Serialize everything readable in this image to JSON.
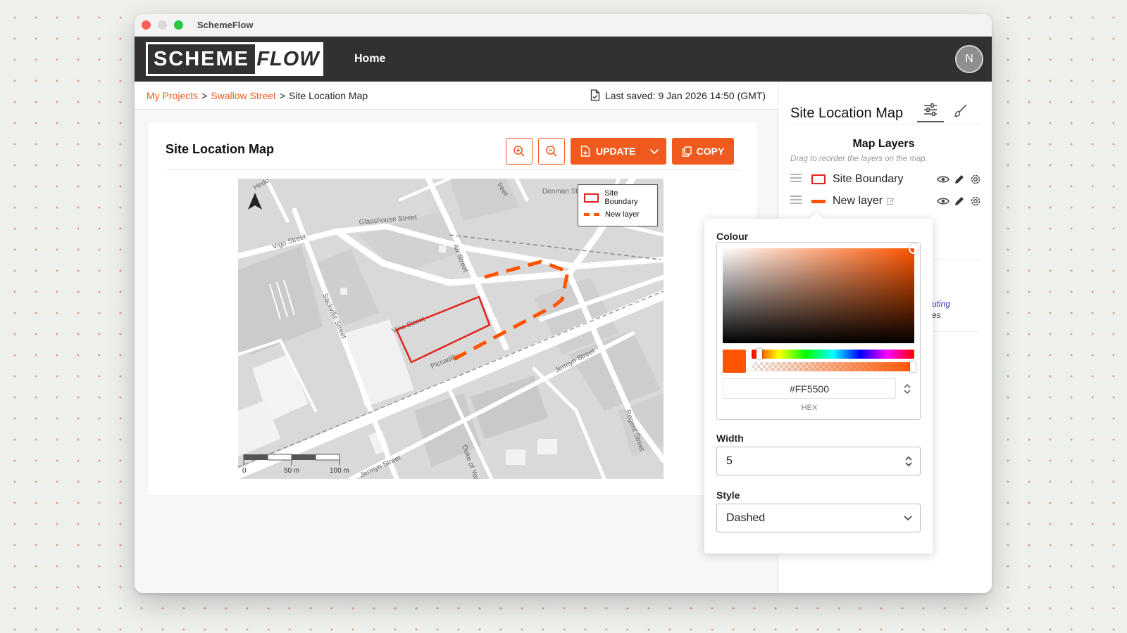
{
  "window": {
    "title": "SchemeFlow"
  },
  "navbar": {
    "logo_left": "SCHEME",
    "logo_right": "FLOW",
    "home_label": "Home",
    "avatar_initial": "N"
  },
  "breadcrumb": {
    "items": [
      "My Projects",
      "Swallow Street",
      "Site Location Map"
    ],
    "separator": ">"
  },
  "last_saved": "Last saved: 9 Jan 2026 14:50 (GMT)",
  "card": {
    "title": "Site Location Map",
    "update_label": "UPDATE",
    "copy_label": "COPY"
  },
  "map": {
    "street_labels": [
      "Glasshouse Street",
      "Vigo Street",
      "Air Street",
      "Sackville Street",
      "Vine Street",
      "Piccadilly",
      "Jermyn Street",
      "Regent Street",
      "Duke of York",
      "Jermyn Street",
      "Denman Street",
      "Hedd",
      "treet"
    ],
    "legend": [
      "Site Boundary",
      "New layer"
    ],
    "scale": [
      "0",
      "50 m",
      "100 m"
    ]
  },
  "sidebar": {
    "title": "Site Location Map",
    "layers_heading": "Map Layers",
    "layers_hint": "Drag to reorder the layers on the map.",
    "layers": [
      {
        "name": "Site Boundary",
        "style": "outline"
      },
      {
        "name": "New layer",
        "style": "dashed"
      }
    ],
    "partial_lines": [
      "uting",
      "es"
    ]
  },
  "style_popover": {
    "colour_label": "Colour",
    "hex_value": "#FF5500",
    "hex_label": "HEX",
    "width_label": "Width",
    "width_value": "5",
    "style_label": "Style",
    "style_value": "Dashed"
  },
  "colors": {
    "accent": "#f05a1e",
    "selected_colour": "#ff5500",
    "boundary_red": "#e0251d",
    "navbar_bg": "#323030"
  }
}
